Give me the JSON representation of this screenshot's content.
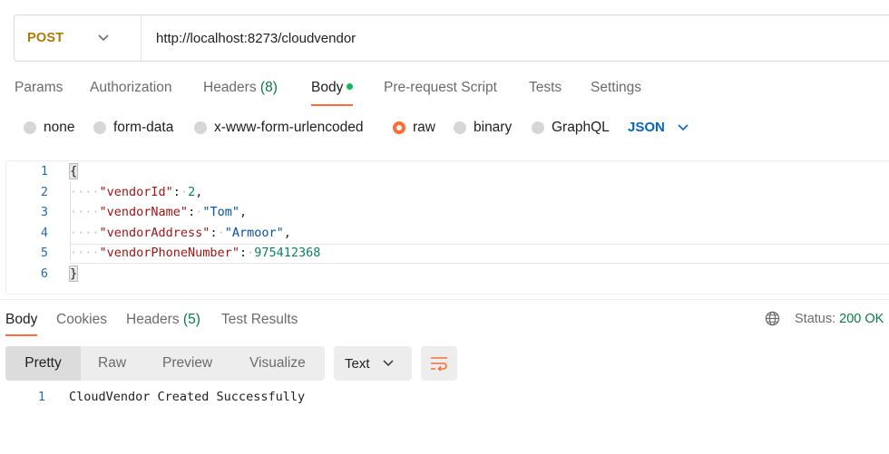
{
  "request": {
    "method": "POST",
    "url": "http://localhost:8273/cloudvendor"
  },
  "request_tabs": [
    {
      "label": "Params"
    },
    {
      "label": "Authorization"
    },
    {
      "label": "Headers",
      "count": "(8)"
    },
    {
      "label": "Body",
      "active": true
    },
    {
      "label": "Pre-request Script"
    },
    {
      "label": "Tests"
    },
    {
      "label": "Settings"
    }
  ],
  "body_types": [
    {
      "label": "none",
      "selected": false
    },
    {
      "label": "form-data",
      "selected": false
    },
    {
      "label": "x-www-form-urlencoded",
      "selected": false
    },
    {
      "label": "raw",
      "selected": true
    },
    {
      "label": "binary",
      "selected": false
    },
    {
      "label": "GraphQL",
      "selected": false
    }
  ],
  "body_format": "JSON",
  "editor": {
    "line_numbers": [
      "1",
      "2",
      "3",
      "4",
      "5",
      "6"
    ],
    "open_brace": "{",
    "close_brace": "}",
    "fields": [
      {
        "key": "\"vendorId\"",
        "value": "2",
        "comma": ","
      },
      {
        "key": "\"vendorName\"",
        "value": "\"Tom\"",
        "comma": ","
      },
      {
        "key": "\"vendorAddress\"",
        "value": "\"Armoor\"",
        "comma": ","
      },
      {
        "key": "\"vendorPhoneNumber\"",
        "value": "975412368",
        "comma": ""
      }
    ]
  },
  "response_tabs": [
    {
      "label": "Body",
      "active": true
    },
    {
      "label": "Cookies"
    },
    {
      "label": "Headers",
      "count": "(5)"
    },
    {
      "label": "Test Results"
    }
  ],
  "status": {
    "label": "Status:",
    "value": "200 OK"
  },
  "view_modes": [
    {
      "label": "Pretty",
      "active": true
    },
    {
      "label": "Raw"
    },
    {
      "label": "Preview"
    },
    {
      "label": "Visualize"
    }
  ],
  "response_format": "Text",
  "response_body": {
    "line_number": "1",
    "text": "CloudVendor Created Successfully"
  },
  "colors": {
    "accent": "#ff6c37",
    "method": "#ad7a03",
    "link": "#0265d2",
    "success": "#0a7a45"
  },
  "icons": [
    "chevron-down-icon",
    "globe-icon",
    "wrap-lines-icon"
  ]
}
